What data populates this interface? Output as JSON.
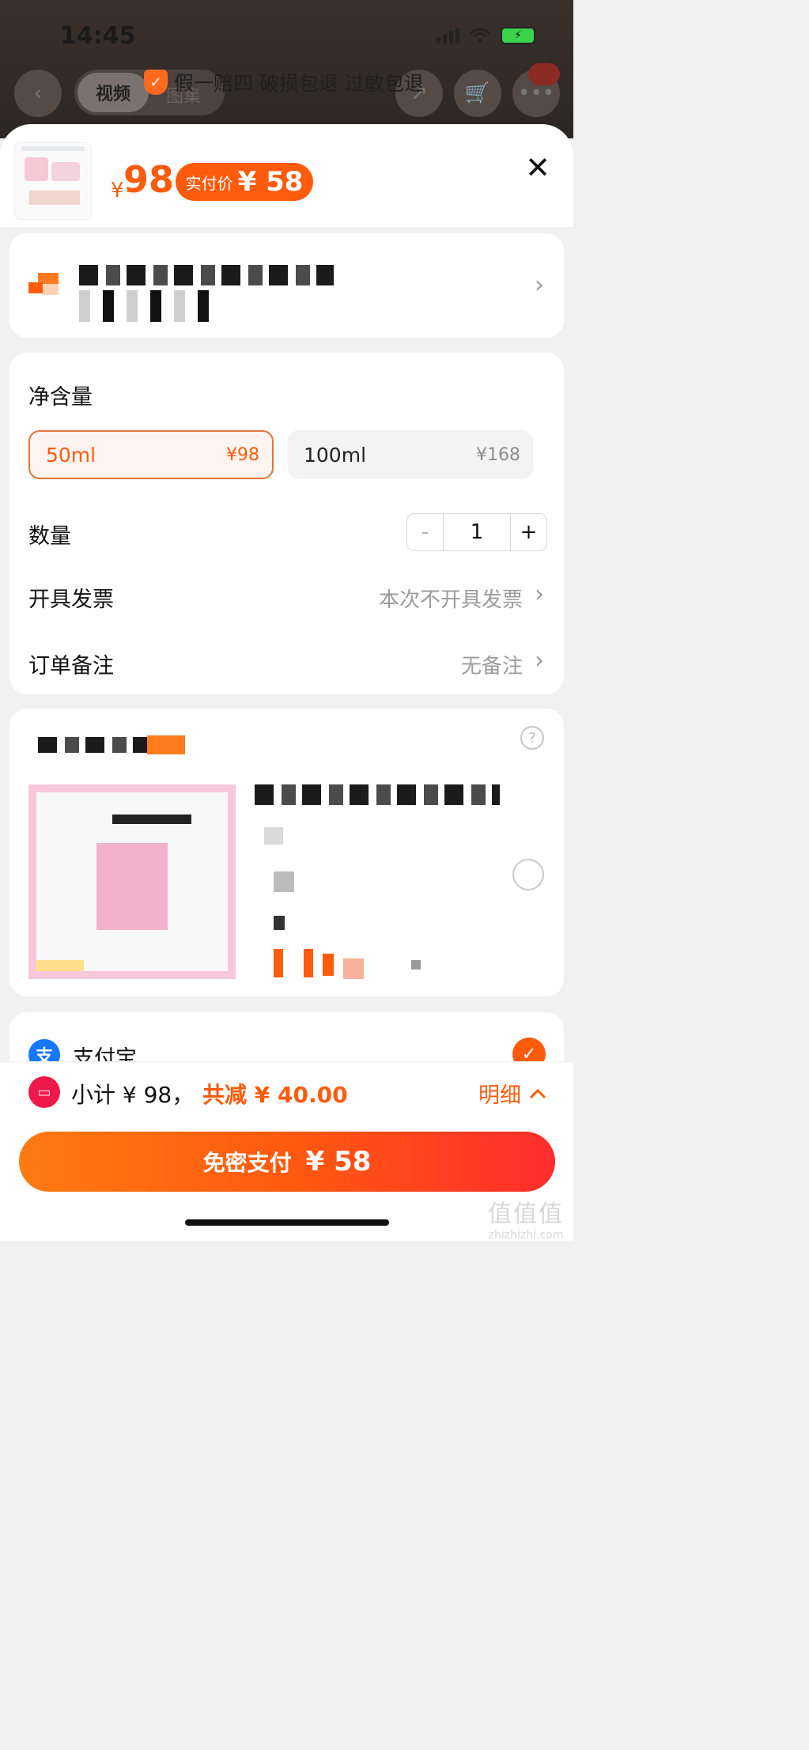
{
  "status": {
    "time": "14:45"
  },
  "nav": {
    "tab_video": "视频",
    "tab_image": "图集",
    "guarantee": "假一赔四 破损包退 过敏包退"
  },
  "header": {
    "price_symbol": "¥",
    "price": "98",
    "real_price_label": "实付价",
    "real_price": "¥ 58"
  },
  "options": {
    "net_content_title": "净含量",
    "specs": [
      {
        "name": "50ml",
        "price": "¥98",
        "selected": true
      },
      {
        "name": "100ml",
        "price": "¥168",
        "selected": false
      }
    ],
    "quantity_label": "数量",
    "quantity_minus": "-",
    "quantity_value": "1",
    "quantity_plus": "+",
    "invoice_label": "开具发票",
    "invoice_value": "本次不开具发票",
    "note_label": "订单备注",
    "note_value": "无备注"
  },
  "payment": {
    "method": "支付宝"
  },
  "footer": {
    "subtotal": "小计 ¥ 98，",
    "discount": "共减 ¥ 40.00",
    "detail": "明细",
    "pay_label": "免密支付",
    "pay_amount": "¥ 58"
  },
  "watermark": {
    "text": "值值值",
    "url": "zhizhizhi.com"
  },
  "colors": {
    "accent": "#ff5b0d",
    "alipay": "#1677ff",
    "coupon": "#f0174a"
  },
  "icons": [
    "back-icon",
    "share-icon",
    "cart-icon",
    "more-icon",
    "close-icon",
    "chevron-right-icon",
    "help-icon",
    "check-icon",
    "chevron-up-icon"
  ]
}
